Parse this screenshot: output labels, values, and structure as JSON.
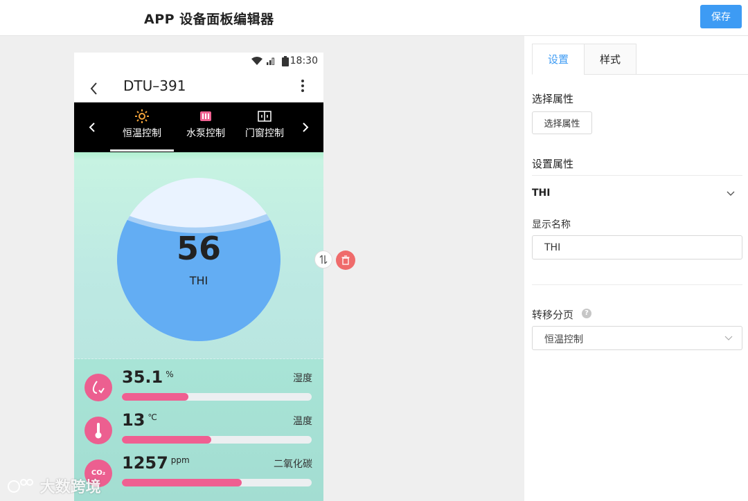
{
  "header": {
    "title": "APP 设备面板编辑器",
    "save_label": "保存"
  },
  "phone": {
    "status_time": "18:30",
    "nav_back_icon": "chevron-left-icon",
    "nav_title": "DTU–391",
    "nav_more_icon": "more-vertical-icon",
    "tabs": [
      {
        "label": "恒温控制",
        "icon": "sun-icon",
        "active": true
      },
      {
        "label": "水泵控制",
        "icon": "pump-icon",
        "active": false
      },
      {
        "label": "门窗控制",
        "icon": "window-icon",
        "active": false
      }
    ],
    "gauge": {
      "value": "56",
      "label": "THI"
    },
    "sensors": [
      {
        "value": "35.1",
        "unit": "%",
        "name": "湿度",
        "icon": "humidity-icon",
        "icon_text": "",
        "level": 0.35
      },
      {
        "value": "13",
        "unit": "℃",
        "name": "温度",
        "icon": "thermometer-icon",
        "icon_text": "",
        "level": 0.47
      },
      {
        "value": "1257",
        "unit": "ppm",
        "name": "二氧化碳",
        "icon": "co2-icon",
        "icon_text": "CO₂",
        "level": 0.63
      }
    ]
  },
  "panel": {
    "tabs": [
      "设置",
      "样式"
    ],
    "select_attr_title": "选择属性",
    "select_attr_button": "选择属性",
    "set_attr_title": "设置属性",
    "property_name": "THI",
    "display_name_label": "显示名称",
    "display_name_value": "THI",
    "transfer_label": "转移分页",
    "transfer_value": "恒温控制"
  },
  "watermark": "大数跨境",
  "colors": {
    "accent": "#3d9bf4",
    "pink": "#ef5f91",
    "gauge_blue": "#63adf3",
    "delete_red": "#ef6b6b"
  }
}
